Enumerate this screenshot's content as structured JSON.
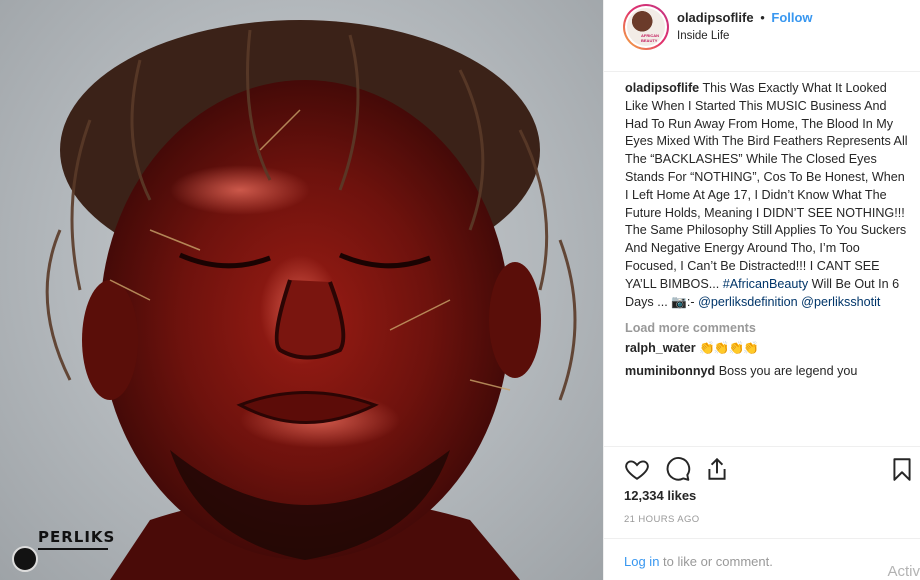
{
  "photo": {
    "watermark": "PERLIKS",
    "description_icon": "photo"
  },
  "header": {
    "username": "oladipsoflife",
    "separator": "•",
    "follow_label": "Follow",
    "location": "Inside Life",
    "avatar_text": "AFRICAN BEAUTY"
  },
  "caption": {
    "username": "oladipsoflife",
    "text": "This Was Exactly What It Looked Like When I Started This MUSIC Business And Had To Run Away From Home, The Blood In My Eyes Mixed With The Bird Feathers Represents All The “BACKLASHES” While The Closed Eyes Stands For “NOTHING”, Cos To Be Honest, When I Left Home At Age 17, I Didn’t Know What The Future Holds, Meaning I DIDN’T SEE NOTHING!!! The Same Philosophy Still Applies To You Suckers And Negative Energy Around Tho, I’m Too Focused, I Can’t Be Distracted!!! I CANT SEE YA’LL BIMBOS...",
    "hashtag": "#AfricanBeauty",
    "text_after": "Will Be Out In 6 Days ... 📷:-",
    "mention1": "@perliksdefinition",
    "mention2": "@perliksshotit"
  },
  "load_more_label": "Load more comments",
  "comments": [
    {
      "username": "ralph_water",
      "text": "👏👏👏👏"
    },
    {
      "username": "muminibonnyd",
      "text": "Boss you are legend you"
    }
  ],
  "actions": {
    "like_icon": "heart-icon",
    "comment_icon": "comment-icon",
    "share_icon": "share-icon",
    "save_icon": "bookmark-icon"
  },
  "likes": "12,334 likes",
  "timestamp": "21 HOURS AGO",
  "login": {
    "link": "Log in",
    "text": "to like or comment."
  },
  "overlay_text": "Activ",
  "colors": {
    "link_blue": "#3897f0",
    "hashtag": "#003569",
    "muted": "#999999",
    "border": "#efefef"
  }
}
